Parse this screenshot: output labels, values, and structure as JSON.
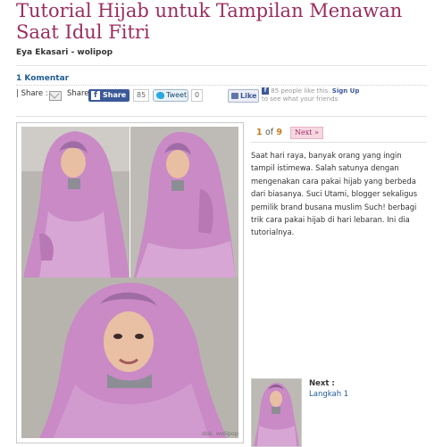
{
  "article": {
    "title": "Tutorial Hijab untuk Tampilan Menawan Saat Idul Fitri",
    "byline": "Eya Ekasari - wolipop",
    "comments_label": "1 Komentar"
  },
  "share_bar": {
    "share_label": "| Share :",
    "share_text": "Share",
    "fb_share_label": "Share",
    "fb_share_count": "85",
    "tweet_label": "Tweet",
    "tweet_count": "0",
    "like_label": "Like",
    "fb_social_text": "85 people like this.",
    "fb_signup": "Sign Up",
    "fb_social_text2": "to see what your friends"
  },
  "gallery": {
    "current_page": "1",
    "of_label": "of",
    "total_pages": "9",
    "next_label": "Next »",
    "photo_credit": "dok. wolipop",
    "description": "Saat hari raya, banyak orang yang ingin tampil istimewa. Salah satunya dengan mengenakan cara pakai hijab yang berbeda dari biasanya. Suci Utami, blogger sekaligus pemilik brand busana muslim Such! berbagi trik cara pakai hijab di hari lebaran. Ini dia tutorialnya.",
    "next_step_label": "Next :",
    "next_step_link": "Langkah 1"
  },
  "colors": {
    "title": "#9b2c5e",
    "link": "#1f5c99",
    "page_number": "#c37c1c",
    "hijab": "#c98ac5",
    "facebook": "#3b5998"
  }
}
